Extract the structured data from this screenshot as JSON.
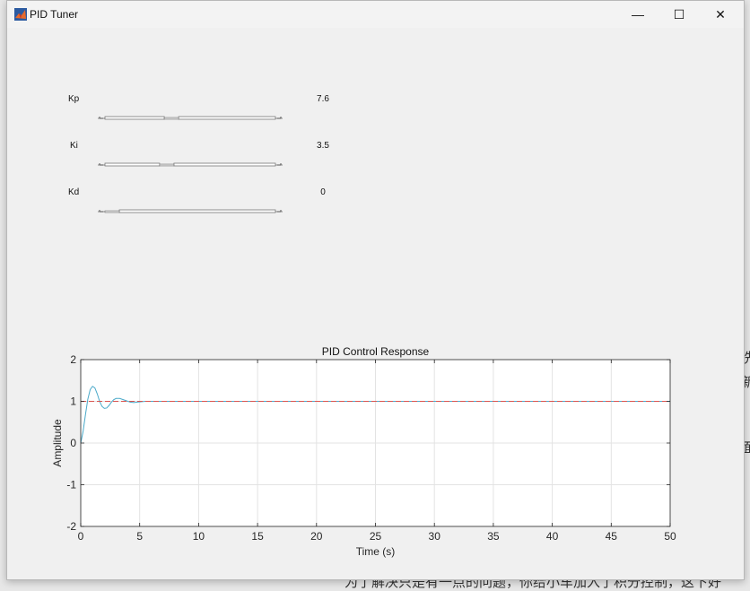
{
  "window": {
    "title": "PID Tuner"
  },
  "titlebar_buttons": {
    "minimize": "—",
    "maximize": "☐",
    "close": "✕"
  },
  "background_text": {
    "right_fragment_1": "冼",
    "right_fragment_2": "新",
    "right_fragment_3": "面",
    "bottom_fragment": "为了解决只是有一点的问题，你给小车加入了积分控制，这下好"
  },
  "params": [
    {
      "label": "Kp",
      "value": "7.6",
      "fraction": 0.38
    },
    {
      "label": "Ki",
      "value": "3.5",
      "fraction": 0.35
    },
    {
      "label": "Kd",
      "value": "0",
      "fraction": 0.0
    }
  ],
  "chart_data": {
    "type": "line",
    "title": "PID Control Response",
    "xlabel": "Time (s)",
    "ylabel": "Amplitude",
    "xlim": [
      0,
      50
    ],
    "ylim": [
      -2,
      2
    ],
    "xticks": [
      "0",
      "5",
      "10",
      "15",
      "20",
      "25",
      "30",
      "35",
      "40",
      "45",
      "50"
    ],
    "yticks": [
      "-2",
      "-1",
      "0",
      "1",
      "2"
    ],
    "grid": true,
    "series": [
      {
        "color": "#4aa9c9",
        "x": [
          0,
          0.2,
          0.4,
          0.6,
          0.8,
          1.0,
          1.2,
          1.4,
          1.6,
          1.8,
          2.0,
          2.2,
          2.4,
          2.6,
          2.8,
          3.0,
          3.3,
          3.6,
          3.9,
          4.2,
          4.5,
          4.8,
          5.1,
          5.5,
          6,
          7,
          8,
          10,
          15,
          20,
          30,
          40,
          50
        ],
        "y": [
          0,
          0.28,
          0.68,
          1.05,
          1.28,
          1.36,
          1.32,
          1.18,
          1.0,
          0.88,
          0.83,
          0.84,
          0.9,
          0.98,
          1.04,
          1.07,
          1.07,
          1.04,
          1.01,
          0.98,
          0.97,
          0.98,
          0.99,
          1.0,
          1.0,
          1.0,
          1.0,
          1.0,
          1.0,
          1.0,
          1.0,
          1.0,
          1.0
        ]
      },
      {
        "color": "#d9534f",
        "dashed": true,
        "x": [
          0,
          50
        ],
        "y": [
          1,
          1
        ]
      }
    ]
  }
}
